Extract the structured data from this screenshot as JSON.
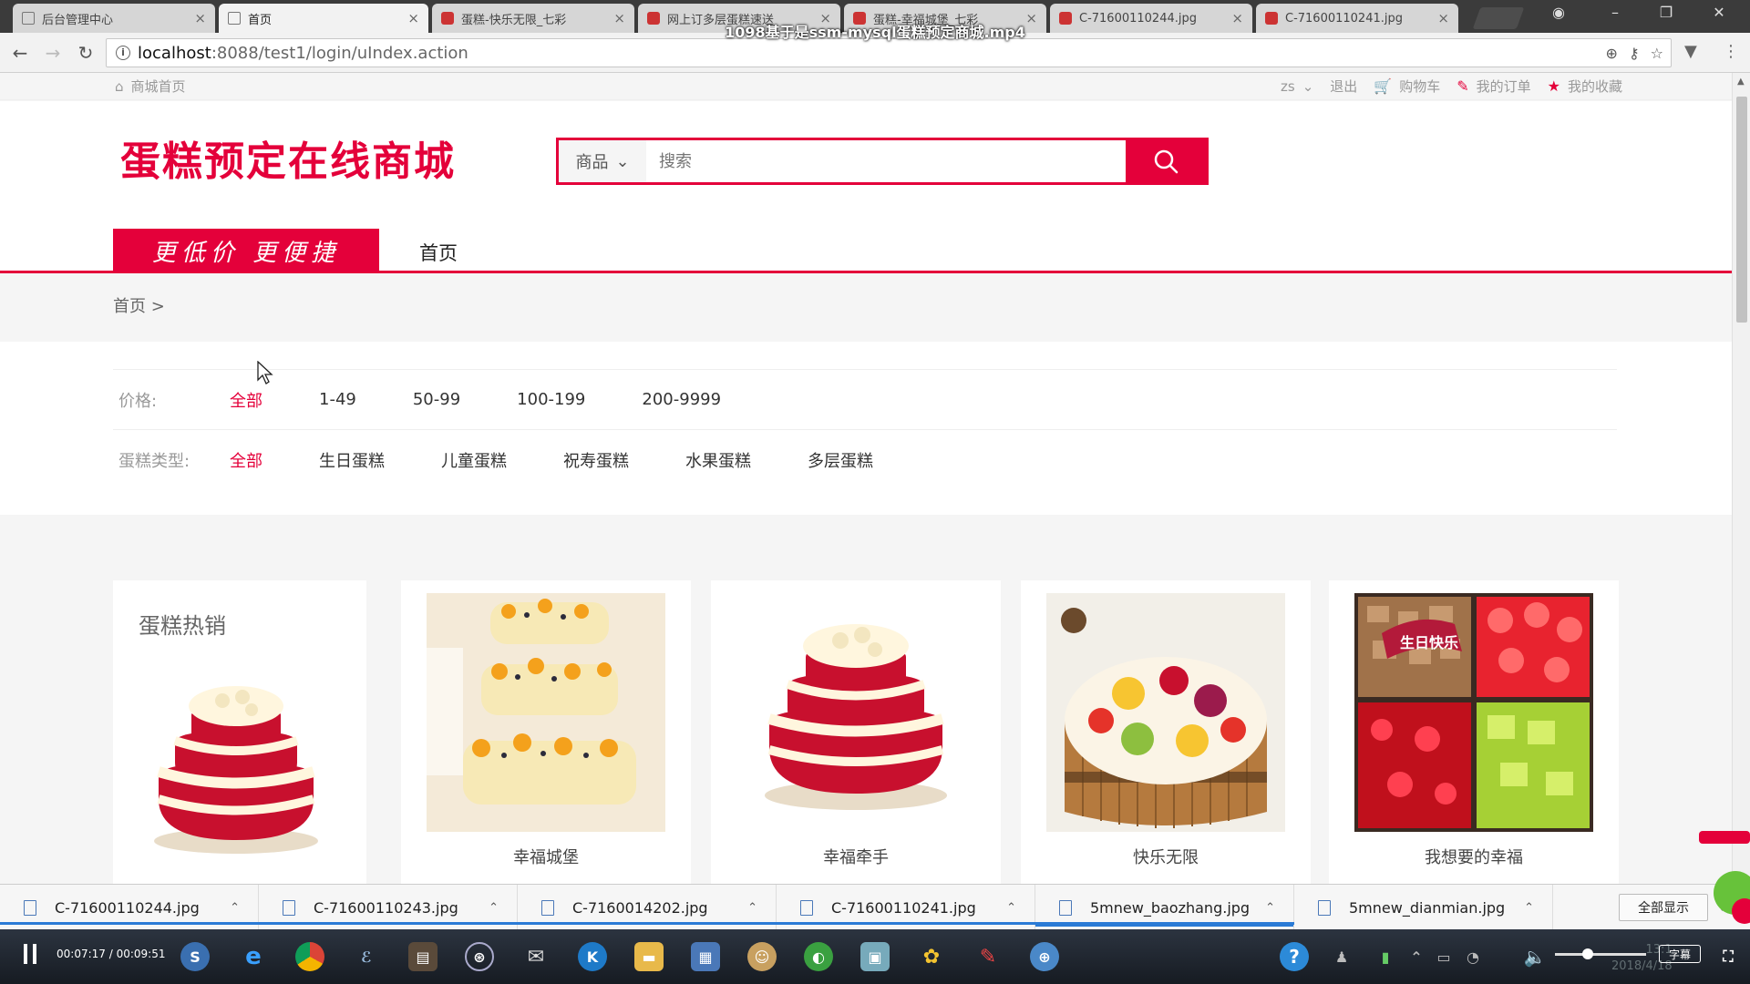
{
  "browser": {
    "tabs": [
      {
        "label": "后台管理中心",
        "active": false
      },
      {
        "label": "首页",
        "active": true
      },
      {
        "label": "蛋糕-快乐无限_七彩",
        "active": false
      },
      {
        "label": "网上订多层蛋糕速送",
        "active": false
      },
      {
        "label": "蛋糕-幸福城堡_七彩",
        "active": false
      },
      {
        "label": "C-71600110244.jpg",
        "active": false
      },
      {
        "label": "C-71600110241.jpg",
        "active": false
      }
    ],
    "url_host": "localhost",
    "url_path": ":8088/test1/login/uIndex.action"
  },
  "video_title": "1098基于是ssm-mysql蛋糕预定商城.mp4",
  "topbar": {
    "home_link": "商城首页",
    "user": "zs",
    "logout": "退出",
    "cart": "购物车",
    "orders": "我的订单",
    "favorites": "我的收藏"
  },
  "header": {
    "logo": "蛋糕预定在线商城",
    "search_category": "商品",
    "search_placeholder": "搜索"
  },
  "nav": {
    "slogan": "更低价 更便捷",
    "home": "首页"
  },
  "breadcrumb": "首页 >",
  "filters": {
    "price_label": "价格:",
    "price_options": [
      "全部",
      "1-49",
      "50-99",
      "100-199",
      "200-9999"
    ],
    "type_label": "蛋糕类型:",
    "type_options": [
      "全部",
      "生日蛋糕",
      "儿童蛋糕",
      "祝寿蛋糕",
      "水果蛋糕",
      "多层蛋糕"
    ]
  },
  "products": {
    "hot_title": "蛋糕热销",
    "items": [
      {
        "name": "幸福城堡"
      },
      {
        "name": "幸福牵手"
      },
      {
        "name": "快乐无限"
      },
      {
        "name": "我想要的幸福"
      }
    ]
  },
  "downloads": {
    "items": [
      "C-71600110244.jpg",
      "C-71600110243.jpg",
      "C-7160014202.jpg",
      "C-71600110241.jpg",
      "5mnew_baozhang.jpg",
      "5mnew_dianmian.jpg"
    ],
    "show_all": "全部显示"
  },
  "player": {
    "time": "00:07:17 / 00:09:51",
    "subtitle_btn": "字幕"
  },
  "clock": {
    "time": "13:1",
    "date": "2018/4/18"
  },
  "colors": {
    "brand": "#e4003a",
    "download_progress": "#2b7bd6"
  }
}
